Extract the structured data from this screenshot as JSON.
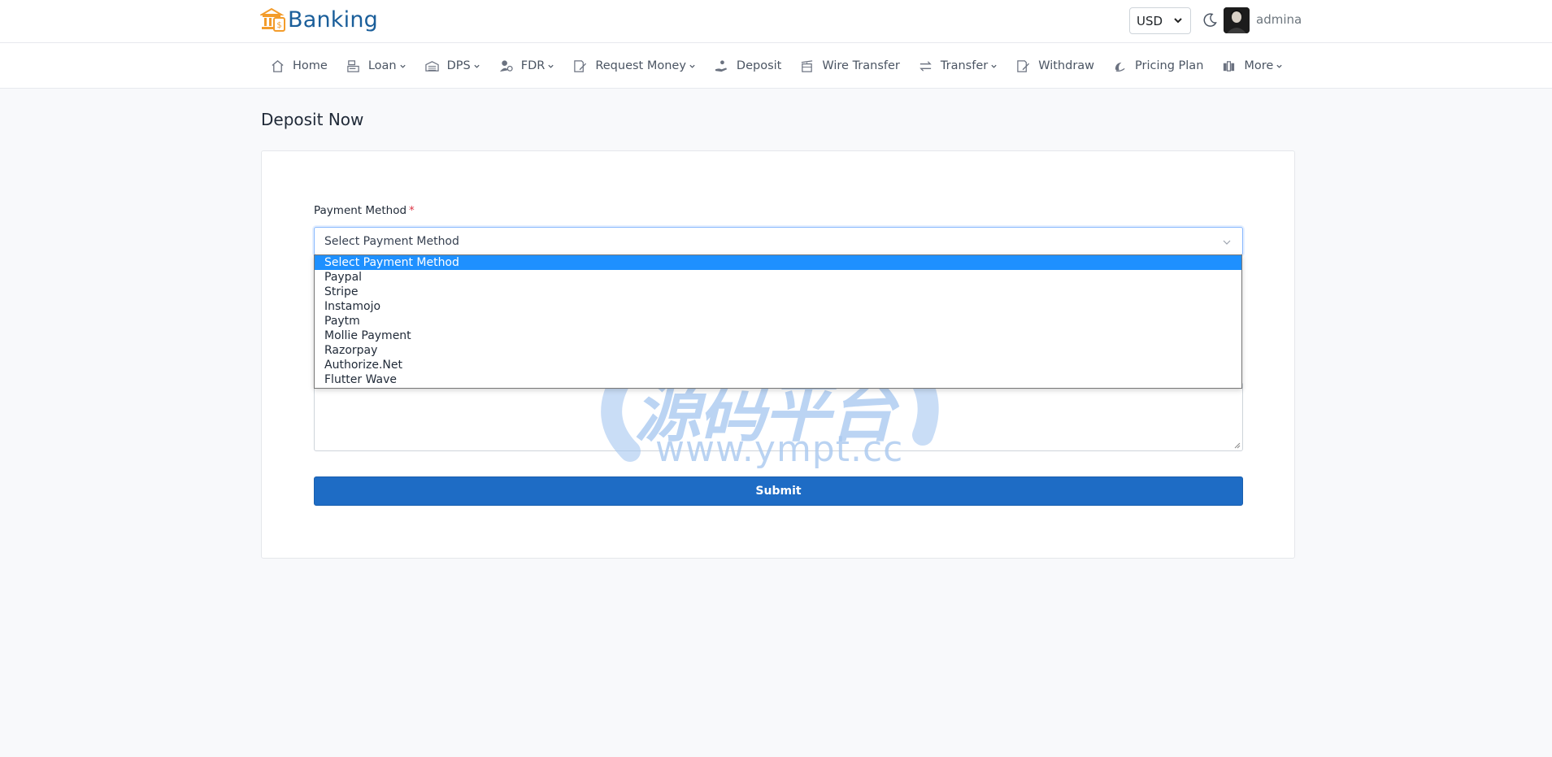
{
  "brand": {
    "name": "Banking"
  },
  "header": {
    "currency": "USD",
    "username": "admina"
  },
  "nav": {
    "items": [
      {
        "label": "Home",
        "icon": "home-icon",
        "dropdown": false
      },
      {
        "label": "Loan",
        "icon": "loan-icon",
        "dropdown": true
      },
      {
        "label": "DPS",
        "icon": "dps-icon",
        "dropdown": true
      },
      {
        "label": "FDR",
        "icon": "fdr-icon",
        "dropdown": true
      },
      {
        "label": "Request Money",
        "icon": "request-money-icon",
        "dropdown": true
      },
      {
        "label": "Deposit",
        "icon": "deposit-icon",
        "dropdown": false
      },
      {
        "label": "Wire Transfer",
        "icon": "wire-transfer-icon",
        "dropdown": false
      },
      {
        "label": "Transfer",
        "icon": "transfer-icon",
        "dropdown": true
      },
      {
        "label": "Withdraw",
        "icon": "withdraw-icon",
        "dropdown": false
      },
      {
        "label": "Pricing Plan",
        "icon": "pricing-plan-icon",
        "dropdown": false
      },
      {
        "label": "More",
        "icon": "more-icon",
        "dropdown": true
      }
    ]
  },
  "page": {
    "title": "Deposit Now"
  },
  "form": {
    "payment_method_label": "Payment Method",
    "required_mark": "*",
    "payment_method_value": "Select Payment Method",
    "options": [
      "Select Payment Method",
      "Paypal",
      "Stripe",
      "Instamojo",
      "Paytm",
      "Mollie Payment",
      "Razorpay",
      "Authorize.Net",
      "Flutter Wave"
    ],
    "selected_index": 0,
    "submit_label": "Submit"
  },
  "watermark": {
    "cn": "源码平台",
    "url": "www.ympt.cc"
  },
  "colors": {
    "brand": "#1a5e9a",
    "accent": "#1e6cc5",
    "selected_option": "#1e90ff",
    "logo_orange": "#f39c2b"
  }
}
